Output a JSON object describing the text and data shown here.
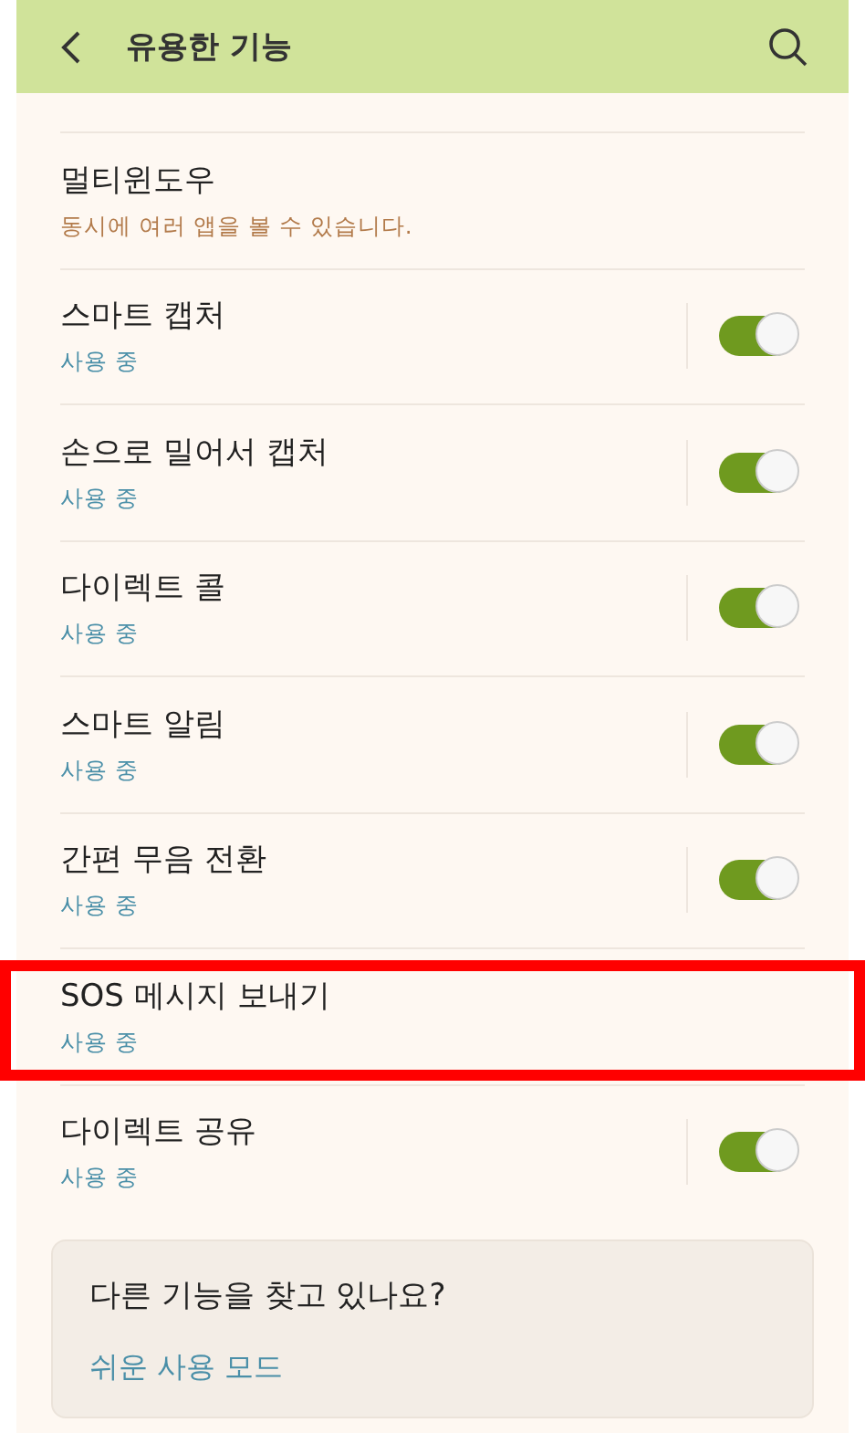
{
  "header": {
    "title": "유용한 기능"
  },
  "items": [
    {
      "kind": "plain",
      "title": "멀티윈도우",
      "description": "동시에 여러 앱을 볼 수 있습니다.",
      "highlighted": false
    },
    {
      "kind": "toggle",
      "title": "스마트 캡처",
      "status": "사용 중",
      "on": true,
      "highlighted": false
    },
    {
      "kind": "toggle",
      "title": "손으로 밀어서 캡처",
      "status": "사용 중",
      "on": true,
      "highlighted": false
    },
    {
      "kind": "toggle",
      "title": "다이렉트 콜",
      "status": "사용 중",
      "on": true,
      "highlighted": false
    },
    {
      "kind": "toggle",
      "title": "스마트 알림",
      "status": "사용 중",
      "on": true,
      "highlighted": false
    },
    {
      "kind": "toggle",
      "title": "간편 무음 전환",
      "status": "사용 중",
      "on": true,
      "highlighted": false
    },
    {
      "kind": "plain",
      "title": "SOS 메시지 보내기",
      "status": "사용 중",
      "highlighted": true
    },
    {
      "kind": "toggle",
      "title": "다이렉트 공유",
      "status": "사용 중",
      "on": true,
      "highlighted": false
    }
  ],
  "suggestion": {
    "question": "다른 기능을 찾고 있나요?",
    "link": "쉬운 사용 모드"
  }
}
